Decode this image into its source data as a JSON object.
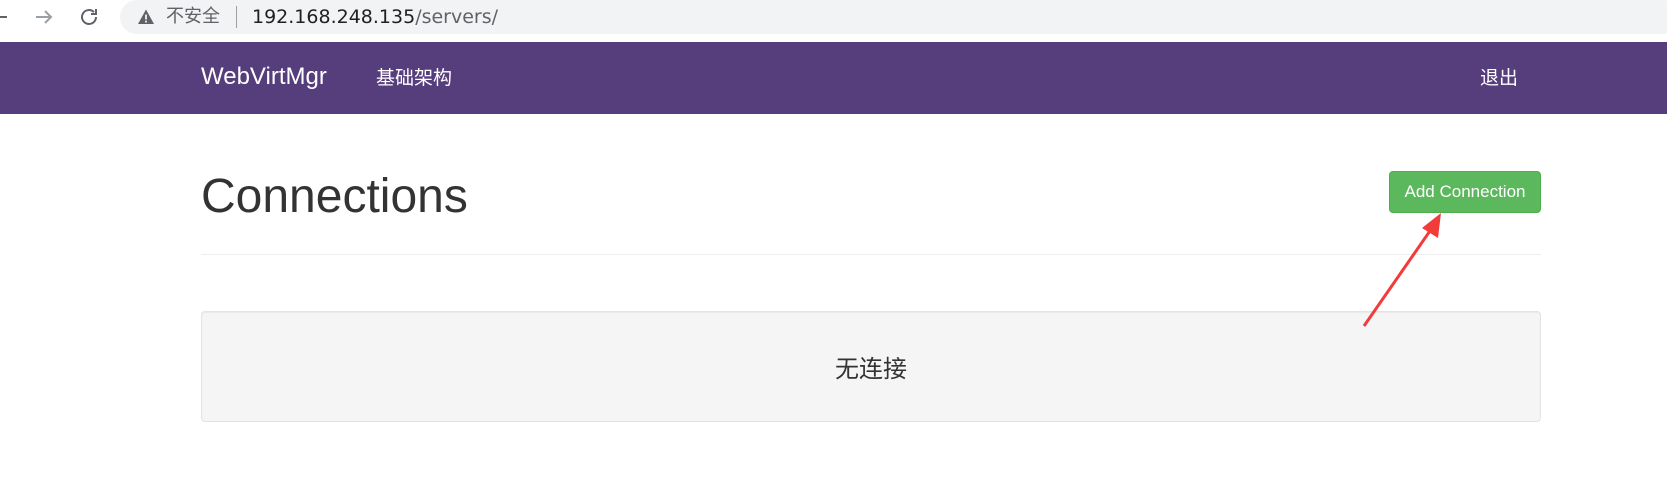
{
  "browser": {
    "insecure_label": "不安全",
    "url_host": "192.168.248.135",
    "url_path": "/servers/"
  },
  "navbar": {
    "brand": "WebVirtMgr",
    "links": [
      "基础架构"
    ],
    "logout": "退出"
  },
  "page": {
    "title": "Connections",
    "add_button": "Add Connection",
    "empty_message": "无连接"
  },
  "colors": {
    "navbar": "#563d7c",
    "add_button": "#5cb85c",
    "annotation_arrow": "#f23b3b"
  }
}
